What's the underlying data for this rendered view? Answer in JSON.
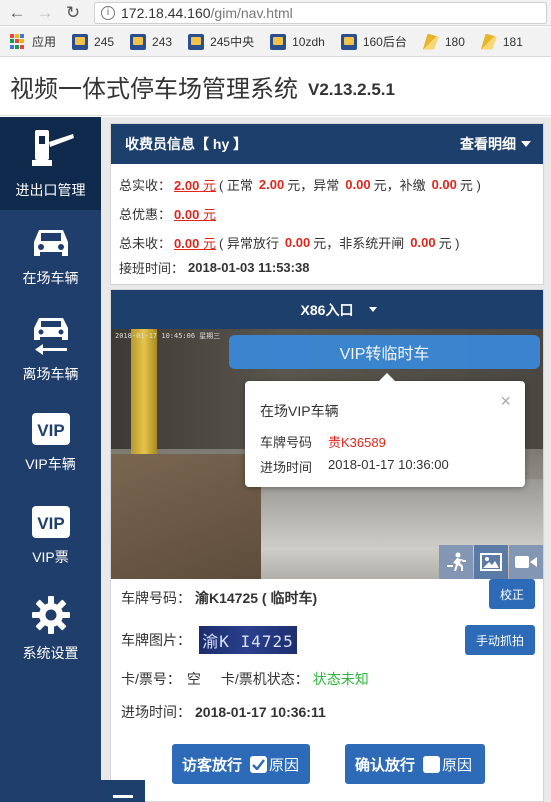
{
  "browser": {
    "url_host": "172.18.44.160",
    "url_path": "/gim/nav.html",
    "bookmarks": [
      {
        "label": "应用",
        "icon": "apps-grid-icon"
      },
      {
        "label": "245",
        "icon": "bookmark-icon"
      },
      {
        "label": "243",
        "icon": "bookmark-icon"
      },
      {
        "label": "245中央",
        "icon": "bookmark-icon"
      },
      {
        "label": "10zdh",
        "icon": "bookmark-icon"
      },
      {
        "label": "160后台",
        "icon": "bookmark-icon"
      },
      {
        "label": "180",
        "icon": "bookmark-gold-icon"
      },
      {
        "label": "181",
        "icon": "bookmark-gold-icon"
      }
    ]
  },
  "header": {
    "title": "视频一体式停车场管理系统",
    "version": "V2.13.2.5.1"
  },
  "sidebar": {
    "items": [
      {
        "label": "进出口管理",
        "icon": "gate-barrier-icon",
        "active": true
      },
      {
        "label": "在场车辆",
        "icon": "car-icon"
      },
      {
        "label": "离场车辆",
        "icon": "car-exit-icon"
      },
      {
        "label": "VIP车辆",
        "icon": "vip-icon"
      },
      {
        "label": "VIP票",
        "icon": "vip-icon"
      },
      {
        "label": "系统设置",
        "icon": "gear-icon"
      }
    ]
  },
  "cashier": {
    "title": "收费员信息【 hy 】",
    "detail_label": "查看明细",
    "actual_label": "总实收：",
    "actual_value": "2.00",
    "actual_unit": "元",
    "normal_label": "( 正常",
    "normal_value": "2.00",
    "normal_unit": "元，异常",
    "abnormal_value": "0.00",
    "abnormal_unit": "元，补缴",
    "supplement_value": "0.00",
    "supplement_unit": "元 )",
    "discount_label": "总优惠：",
    "discount_value": "0.00",
    "discount_unit": "元",
    "unpaid_label": "总未收：",
    "unpaid_value": "0.00",
    "unpaid_unit": "元",
    "unpaid_abn_label": "( 异常放行",
    "unpaid_abn_value": "0.00",
    "unpaid_abn_unit": "元，非系统开闸",
    "unpaid_nonsys_value": "0.00",
    "unpaid_nonsys_unit": "元 )",
    "shift_label": "接班时间：",
    "shift_time": "2018-01-03 11:53:38"
  },
  "gate": {
    "name": "X86入口",
    "camera_timestamp": "2018-01-17 10:45:06 星期三",
    "vip_banner": "VIP转临时车",
    "popover": {
      "title": "在场VIP车辆",
      "plate_label": "车牌号码",
      "plate_value": "贵K36589",
      "time_label": "进场时间",
      "time_value": "2018-01-17 10:36:00"
    },
    "plate_label": "车牌号码：",
    "plate_value": "渝K14725 ( 临时车)",
    "verify_button": "校正",
    "plate_image_label": "车牌图片：",
    "plate_image_text": "渝K I4725",
    "manual_capture_button": "手动抓拍",
    "card_label": "卡/票号：",
    "card_value": "空",
    "machine_label": "卡/票机状态：",
    "machine_status": "状态未知",
    "entry_label": "进场时间：",
    "entry_time": "2018-01-17 10:36:11",
    "visitor_release_button": "访客放行",
    "visitor_reason_label": "原因",
    "visitor_reason_checked": true,
    "confirm_release_button": "确认放行",
    "confirm_reason_label": "原因",
    "confirm_reason_checked": false
  },
  "colors": {
    "sidebar_bg": "#1f3e6b",
    "panel_head": "#1c3f6b",
    "button_blue": "#2d6bb8",
    "accent_red": "#e0251b",
    "status_green": "#2db83d"
  }
}
